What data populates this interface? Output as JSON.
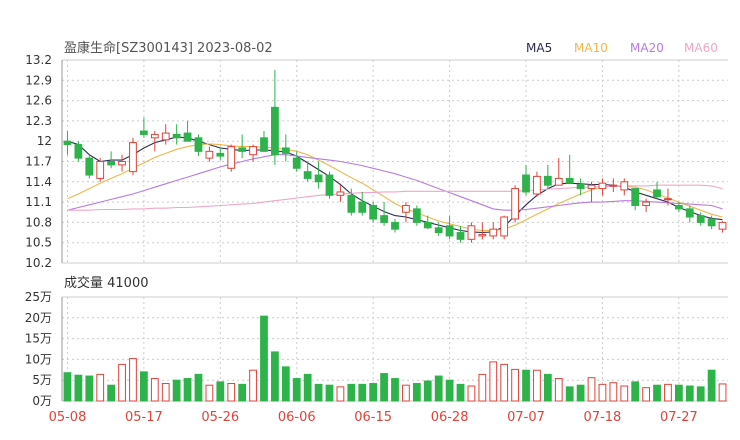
{
  "header": {
    "title": "盈康生命[SZ300143] 2023-08-02",
    "legend": [
      {
        "label": "MA5",
        "color": "#2c2c54"
      },
      {
        "label": "MA10",
        "color": "#f0b64a"
      },
      {
        "label": "MA20",
        "color": "#b77ce0"
      },
      {
        "label": "MA60",
        "color": "#f0a6c8"
      }
    ]
  },
  "colors": {
    "up": "#e0433a",
    "down": "#2db34a",
    "grid": "#cccccc"
  },
  "volume_label": "成交量 41000",
  "chart_data": {
    "type": "candlestick",
    "dates": [
      "05-08",
      "05-09",
      "05-10",
      "05-11",
      "05-12",
      "05-15",
      "05-16",
      "05-17",
      "05-18",
      "05-19",
      "05-22",
      "05-23",
      "05-24",
      "05-25",
      "05-26",
      "05-29",
      "05-30",
      "05-31",
      "06-01",
      "06-02",
      "06-05",
      "06-06",
      "06-07",
      "06-08",
      "06-09",
      "06-12",
      "06-13",
      "06-14",
      "06-15",
      "06-16",
      "06-19",
      "06-20",
      "06-21",
      "06-26",
      "06-27",
      "06-28",
      "06-29",
      "06-30",
      "07-03",
      "07-04",
      "07-05",
      "07-06",
      "07-07",
      "07-10",
      "07-11",
      "07-12",
      "07-13",
      "07-14",
      "07-17",
      "07-18",
      "07-19",
      "07-20",
      "07-21",
      "07-24",
      "07-25",
      "07-26",
      "07-27",
      "07-28",
      "07-31",
      "08-01",
      "08-02"
    ],
    "x_tick_labels": [
      "05-08",
      "05-17",
      "05-26",
      "06-06",
      "06-15",
      "06-28",
      "07-07",
      "07-18",
      "07-27"
    ],
    "candles": [
      [
        12.0,
        12.15,
        11.8,
        11.95
      ],
      [
        11.95,
        12.0,
        11.7,
        11.75
      ],
      [
        11.75,
        11.8,
        11.45,
        11.5
      ],
      [
        11.45,
        11.75,
        11.4,
        11.7
      ],
      [
        11.7,
        11.85,
        11.6,
        11.65
      ],
      [
        11.65,
        11.8,
        11.55,
        11.7
      ],
      [
        11.55,
        12.05,
        11.5,
        11.98
      ],
      [
        12.15,
        12.35,
        12.05,
        12.1
      ],
      [
        12.05,
        12.15,
        11.85,
        12.1
      ],
      [
        12.02,
        12.25,
        11.95,
        12.12
      ],
      [
        12.1,
        12.25,
        11.95,
        12.05
      ],
      [
        12.12,
        12.3,
        12.02,
        12.0
      ],
      [
        12.05,
        12.1,
        11.78,
        11.85
      ],
      [
        11.75,
        11.92,
        11.7,
        11.85
      ],
      [
        11.82,
        11.9,
        11.72,
        11.78
      ],
      [
        11.6,
        11.95,
        11.55,
        11.92
      ],
      [
        11.9,
        12.1,
        11.75,
        11.85
      ],
      [
        11.8,
        11.95,
        11.7,
        11.92
      ],
      [
        12.05,
        12.15,
        11.85,
        11.85
      ],
      [
        12.5,
        13.05,
        11.65,
        11.8
      ],
      [
        11.9,
        12.1,
        11.7,
        11.82
      ],
      [
        11.75,
        11.85,
        11.55,
        11.6
      ],
      [
        11.55,
        11.7,
        11.4,
        11.45
      ],
      [
        11.5,
        11.7,
        11.3,
        11.4
      ],
      [
        11.5,
        11.55,
        11.15,
        11.2
      ],
      [
        11.2,
        11.35,
        11.1,
        11.25
      ],
      [
        11.2,
        11.3,
        10.9,
        10.95
      ],
      [
        11.1,
        11.25,
        10.9,
        10.95
      ],
      [
        11.05,
        11.1,
        10.8,
        10.85
      ],
      [
        10.9,
        11.1,
        10.75,
        10.8
      ],
      [
        10.8,
        10.85,
        10.65,
        10.7
      ],
      [
        10.95,
        11.1,
        10.8,
        11.05
      ],
      [
        11.0,
        11.05,
        10.75,
        10.8
      ],
      [
        10.8,
        10.9,
        10.7,
        10.72
      ],
      [
        10.72,
        10.8,
        10.6,
        10.65
      ],
      [
        10.75,
        10.9,
        10.55,
        10.6
      ],
      [
        10.65,
        10.75,
        10.5,
        10.55
      ],
      [
        10.55,
        10.8,
        10.5,
        10.75
      ],
      [
        10.6,
        10.8,
        10.55,
        10.62
      ],
      [
        10.6,
        10.8,
        10.55,
        10.7
      ],
      [
        10.6,
        10.9,
        10.55,
        10.88
      ],
      [
        10.85,
        11.35,
        10.8,
        11.3
      ],
      [
        11.5,
        11.65,
        11.2,
        11.25
      ],
      [
        11.22,
        11.55,
        11.18,
        11.48
      ],
      [
        11.48,
        11.65,
        11.3,
        11.35
      ],
      [
        11.35,
        11.75,
        11.35,
        11.45
      ],
      [
        11.45,
        11.8,
        11.38,
        11.38
      ],
      [
        11.36,
        11.45,
        11.2,
        11.3
      ],
      [
        11.3,
        11.4,
        11.1,
        11.35
      ],
      [
        11.3,
        11.45,
        11.2,
        11.38
      ],
      [
        11.35,
        11.45,
        11.25,
        11.35
      ],
      [
        11.28,
        11.45,
        11.2,
        11.4
      ],
      [
        11.3,
        11.3,
        10.98,
        11.05
      ],
      [
        11.05,
        11.15,
        10.95,
        11.1
      ],
      [
        11.28,
        11.4,
        11.15,
        11.18
      ],
      [
        11.15,
        11.3,
        11.05,
        11.15
      ],
      [
        11.05,
        11.1,
        10.95,
        11.0
      ],
      [
        11.0,
        11.05,
        10.8,
        10.88
      ],
      [
        10.9,
        10.95,
        10.75,
        10.8
      ],
      [
        10.85,
        10.9,
        10.7,
        10.75
      ],
      [
        10.7,
        10.82,
        10.65,
        10.8
      ]
    ],
    "volume_wan": [
      6.8,
      6.2,
      6.0,
      6.4,
      3.8,
      8.8,
      10.2,
      7.0,
      5.4,
      4.2,
      5.0,
      5.4,
      6.4,
      3.8,
      4.6,
      4.2,
      4.0,
      7.4,
      20.4,
      11.8,
      8.2,
      5.4,
      6.4,
      4.0,
      3.8,
      3.4,
      4.0,
      4.0,
      4.2,
      6.6,
      5.4,
      3.8,
      4.2,
      4.8,
      6.0,
      5.0,
      4.0,
      3.6,
      6.4,
      9.4,
      8.8,
      7.6,
      7.4,
      7.4,
      6.4,
      5.4,
      3.4,
      3.8,
      5.6,
      4.0,
      4.4,
      3.6,
      4.6,
      3.2,
      3.8,
      4.0,
      3.8,
      3.6,
      3.4,
      7.4,
      4.1
    ],
    "ma": {
      "MA5": [
        12.0,
        11.95,
        11.8,
        11.7,
        11.72,
        11.72,
        11.8,
        11.9,
        11.98,
        12.02,
        12.06,
        12.05,
        12.0,
        11.95,
        11.9,
        11.88,
        11.86,
        11.87,
        11.87,
        11.86,
        11.84,
        11.78,
        11.68,
        11.58,
        11.48,
        11.36,
        11.22,
        11.12,
        11.04,
        10.96,
        10.9,
        10.88,
        10.84,
        10.8,
        10.76,
        10.72,
        10.68,
        10.66,
        10.65,
        10.66,
        10.74,
        10.9,
        11.06,
        11.2,
        11.3,
        11.37,
        11.38,
        11.37,
        11.36,
        11.36,
        11.35,
        11.32,
        11.25,
        11.2,
        11.15,
        11.1,
        11.02,
        10.96,
        10.9,
        10.86,
        10.84
      ],
      "MA10": [
        11.15,
        11.22,
        11.3,
        11.38,
        11.45,
        11.52,
        11.6,
        11.68,
        11.76,
        11.82,
        11.88,
        11.92,
        11.95,
        11.96,
        11.95,
        11.93,
        11.92,
        11.92,
        11.91,
        11.9,
        11.88,
        11.85,
        11.8,
        11.72,
        11.64,
        11.55,
        11.46,
        11.38,
        11.28,
        11.18,
        11.08,
        11.0,
        10.94,
        10.88,
        10.82,
        10.78,
        10.74,
        10.7,
        10.68,
        10.68,
        10.7,
        10.76,
        10.84,
        10.92,
        11.0,
        11.08,
        11.15,
        11.22,
        11.28,
        11.32,
        11.34,
        11.34,
        11.32,
        11.28,
        11.22,
        11.16,
        11.1,
        11.04,
        10.98,
        10.92,
        10.88
      ],
      "MA20": [
        10.98,
        11.02,
        11.06,
        11.1,
        11.14,
        11.18,
        11.22,
        11.27,
        11.32,
        11.37,
        11.42,
        11.47,
        11.52,
        11.57,
        11.62,
        11.66,
        11.7,
        11.74,
        11.77,
        11.8,
        11.8,
        11.78,
        11.76,
        11.74,
        11.72,
        11.7,
        11.67,
        11.64,
        11.6,
        11.56,
        11.52,
        11.47,
        11.42,
        11.36,
        11.3,
        11.24,
        11.18,
        11.12,
        11.06,
        11.0,
        10.98,
        10.98,
        10.99,
        11.01,
        11.03,
        11.05,
        11.07,
        11.09,
        11.1,
        11.1,
        11.11,
        11.12,
        11.12,
        11.11,
        11.1,
        11.09,
        11.08,
        11.07,
        11.06,
        11.05,
        11.0
      ],
      "MA60": [
        10.98,
        10.98,
        10.98,
        10.99,
        10.99,
        10.99,
        11.0,
        11.0,
        11.01,
        11.01,
        11.02,
        11.02,
        11.03,
        11.04,
        11.05,
        11.06,
        11.07,
        11.08,
        11.1,
        11.12,
        11.14,
        11.16,
        11.18,
        11.2,
        11.21,
        11.22,
        11.23,
        11.24,
        11.24,
        11.25,
        11.25,
        11.26,
        11.26,
        11.26,
        11.26,
        11.26,
        11.26,
        11.26,
        11.26,
        11.26,
        11.26,
        11.26,
        11.27,
        11.28,
        11.29,
        11.3,
        11.31,
        11.32,
        11.32,
        11.33,
        11.33,
        11.34,
        11.34,
        11.34,
        11.35,
        11.35,
        11.35,
        11.35,
        11.35,
        11.34,
        11.3
      ]
    },
    "ylim": [
      10.2,
      13.2
    ],
    "y_ticks": [
      "13.2",
      "12.9",
      "12.6",
      "12.3",
      "12",
      "11.7",
      "11.4",
      "11.1",
      "10.8",
      "10.5",
      "10.2"
    ],
    "vol_ylim": [
      0,
      25
    ],
    "vol_ticks": [
      "25万",
      "20万",
      "15万",
      "10万",
      "5万",
      "0万"
    ]
  }
}
